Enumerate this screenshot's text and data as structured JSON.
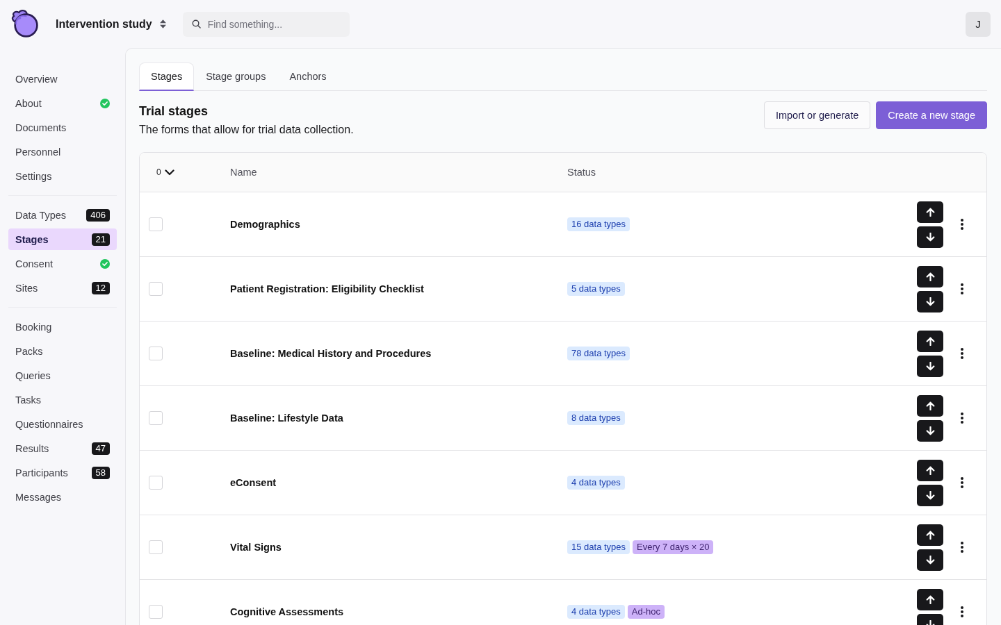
{
  "topbar": {
    "study": "Intervention study",
    "search": {
      "placeholder": "Find something..."
    },
    "user_initial": "J"
  },
  "sidebar": {
    "groups": [
      {
        "items": [
          {
            "label": "Overview",
            "selected": false,
            "completed": false
          },
          {
            "label": "About",
            "selected": false,
            "completed": true
          },
          {
            "label": "Documents",
            "selected": false,
            "completed": false
          },
          {
            "label": "Personnel",
            "selected": false,
            "completed": false
          },
          {
            "label": "Settings",
            "selected": false,
            "completed": false
          }
        ]
      },
      {
        "items": [
          {
            "label": "Data Types",
            "selected": false,
            "completed": false,
            "count": "406"
          },
          {
            "label": "Stages",
            "selected": true,
            "completed": false,
            "count": "21"
          },
          {
            "label": "Consent",
            "selected": false,
            "completed": true
          },
          {
            "label": "Sites",
            "selected": false,
            "completed": false,
            "count": "12"
          }
        ]
      },
      {
        "items": [
          {
            "label": "Booking",
            "selected": false,
            "completed": false
          },
          {
            "label": "Packs",
            "selected": false,
            "completed": false
          },
          {
            "label": "Queries",
            "selected": false,
            "completed": false
          },
          {
            "label": "Tasks",
            "selected": false,
            "completed": false
          },
          {
            "label": "Questionnaires",
            "selected": false,
            "completed": false
          },
          {
            "label": "Results",
            "selected": false,
            "completed": false,
            "count": "47"
          },
          {
            "label": "Participants",
            "selected": false,
            "completed": false,
            "count": "58"
          },
          {
            "label": "Messages",
            "selected": false,
            "completed": false
          }
        ]
      }
    ]
  },
  "tabs": [
    {
      "label": "Stages",
      "selected": true
    },
    {
      "label": "Stage groups",
      "selected": false
    },
    {
      "label": "Anchors",
      "selected": false
    }
  ],
  "header": {
    "title": "Trial stages",
    "subtitle": "The forms that allow for trial data collection.",
    "buttons": [
      {
        "label": "Import or generate",
        "kind": "secondary"
      },
      {
        "label": "Create a new stage",
        "kind": "primary"
      }
    ]
  },
  "table": {
    "selected_count": "0",
    "columns": [
      "Name",
      "Status"
    ],
    "rows": [
      {
        "name": "Demographics",
        "checked": false,
        "tags": [
          {
            "label": "16 data types",
            "kind": "count"
          }
        ]
      },
      {
        "name": "Patient Registration: Eligibility Checklist",
        "checked": false,
        "tags": [
          {
            "label": "5 data types",
            "kind": "count"
          }
        ]
      },
      {
        "name": "Baseline: Medical History and Procedures",
        "checked": false,
        "tags": [
          {
            "label": "78 data types",
            "kind": "count"
          }
        ]
      },
      {
        "name": "Baseline: Lifestyle Data",
        "checked": false,
        "tags": [
          {
            "label": "8 data types",
            "kind": "count"
          }
        ]
      },
      {
        "name": "eConsent",
        "checked": false,
        "tags": [
          {
            "label": "4 data types",
            "kind": "count"
          }
        ]
      },
      {
        "name": "Vital Signs",
        "checked": false,
        "tags": [
          {
            "label": "15 data types",
            "kind": "count"
          },
          {
            "label": "Every 7 days × 20",
            "kind": "schedule"
          }
        ]
      },
      {
        "name": "Cognitive Assessments",
        "checked": false,
        "tags": [
          {
            "label": "4 data types",
            "kind": "count"
          },
          {
            "label": "Ad-hoc",
            "kind": "schedule"
          }
        ]
      }
    ]
  }
}
